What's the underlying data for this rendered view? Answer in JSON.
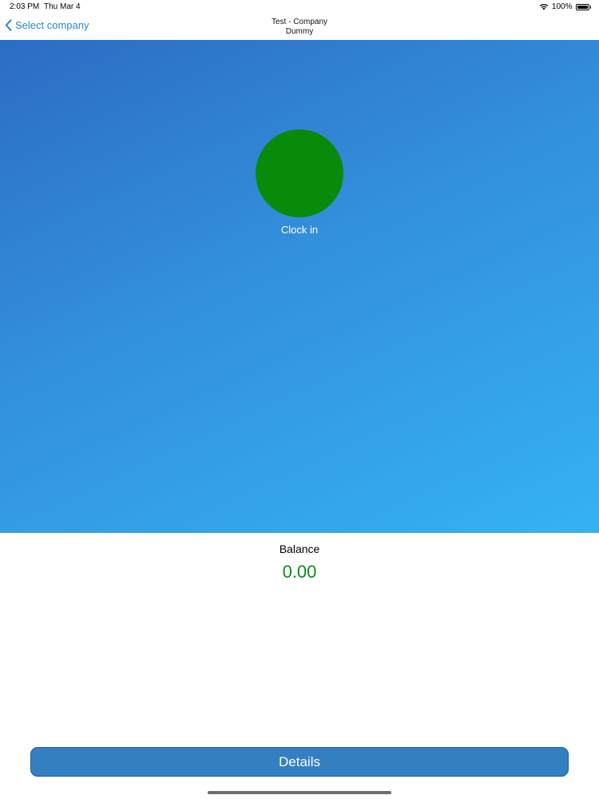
{
  "status_bar": {
    "time": "2:03 PM",
    "date": "Thu Mar 4",
    "battery": "100%",
    "icons": [
      "wifi-icon",
      "battery-icon"
    ]
  },
  "nav": {
    "back_label": "Select company",
    "back_icon": "chevron-left-icon",
    "title_line1": "Test - Company",
    "title_line2": "Dummy"
  },
  "clock": {
    "label": "Clock in",
    "button_color": "#0a8a0a"
  },
  "balance": {
    "label": "Balance",
    "value": "0.00",
    "value_color": "#0f8a1e"
  },
  "footer": {
    "details_label": "Details"
  },
  "colors": {
    "accent": "#2e86c9",
    "hero_start": "#2c6cc4",
    "hero_end": "#35b2f2",
    "details_bg": "#337fc1"
  }
}
